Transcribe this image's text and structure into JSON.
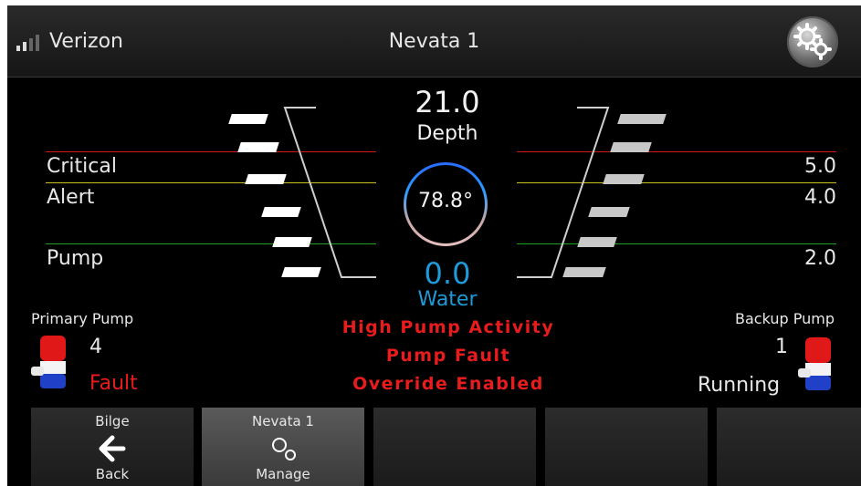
{
  "topbar": {
    "carrier": "Verizon",
    "title": "Nevata 1",
    "signal_bars_lit": 2,
    "signal_bars_total": 4,
    "settings_icon": "gears-icon"
  },
  "gauge": {
    "depth_value": "21.0",
    "depth_label": "Depth",
    "temperature": "78.8°",
    "water_value": "0.0",
    "water_label": "Water",
    "levels": [
      {
        "label": "Critical",
        "value": "5.0",
        "color": "#d01818"
      },
      {
        "label": "Alert",
        "value": "4.0",
        "color": "#c8c020"
      },
      {
        "label": "Pump",
        "value": "2.0",
        "color": "#20a020"
      }
    ],
    "water_color": "#1e9ad8"
  },
  "primary_pump": {
    "label": "Primary Pump",
    "count": "4",
    "status": "Fault",
    "status_color": "#e81c1c",
    "icon": "bilge-pump-icon"
  },
  "backup_pump": {
    "label": "Backup Pump",
    "count": "1",
    "status": "Running",
    "status_color": "#e8e8e8",
    "icon": "bilge-pump-icon"
  },
  "alerts": [
    "High Pump Activity",
    "Pump Fault",
    "Override Enabled"
  ],
  "nav": [
    {
      "top": "Bilge",
      "bottom": "Back",
      "icon": "back-arrow-icon",
      "active": false
    },
    {
      "top": "Nevata 1",
      "bottom": "Manage",
      "icon": "gears-icon",
      "active": true
    },
    {
      "top": "",
      "bottom": "",
      "icon": "",
      "active": false
    },
    {
      "top": "",
      "bottom": "",
      "icon": "",
      "active": false
    },
    {
      "top": "",
      "bottom": "",
      "icon": "",
      "active": false
    }
  ]
}
